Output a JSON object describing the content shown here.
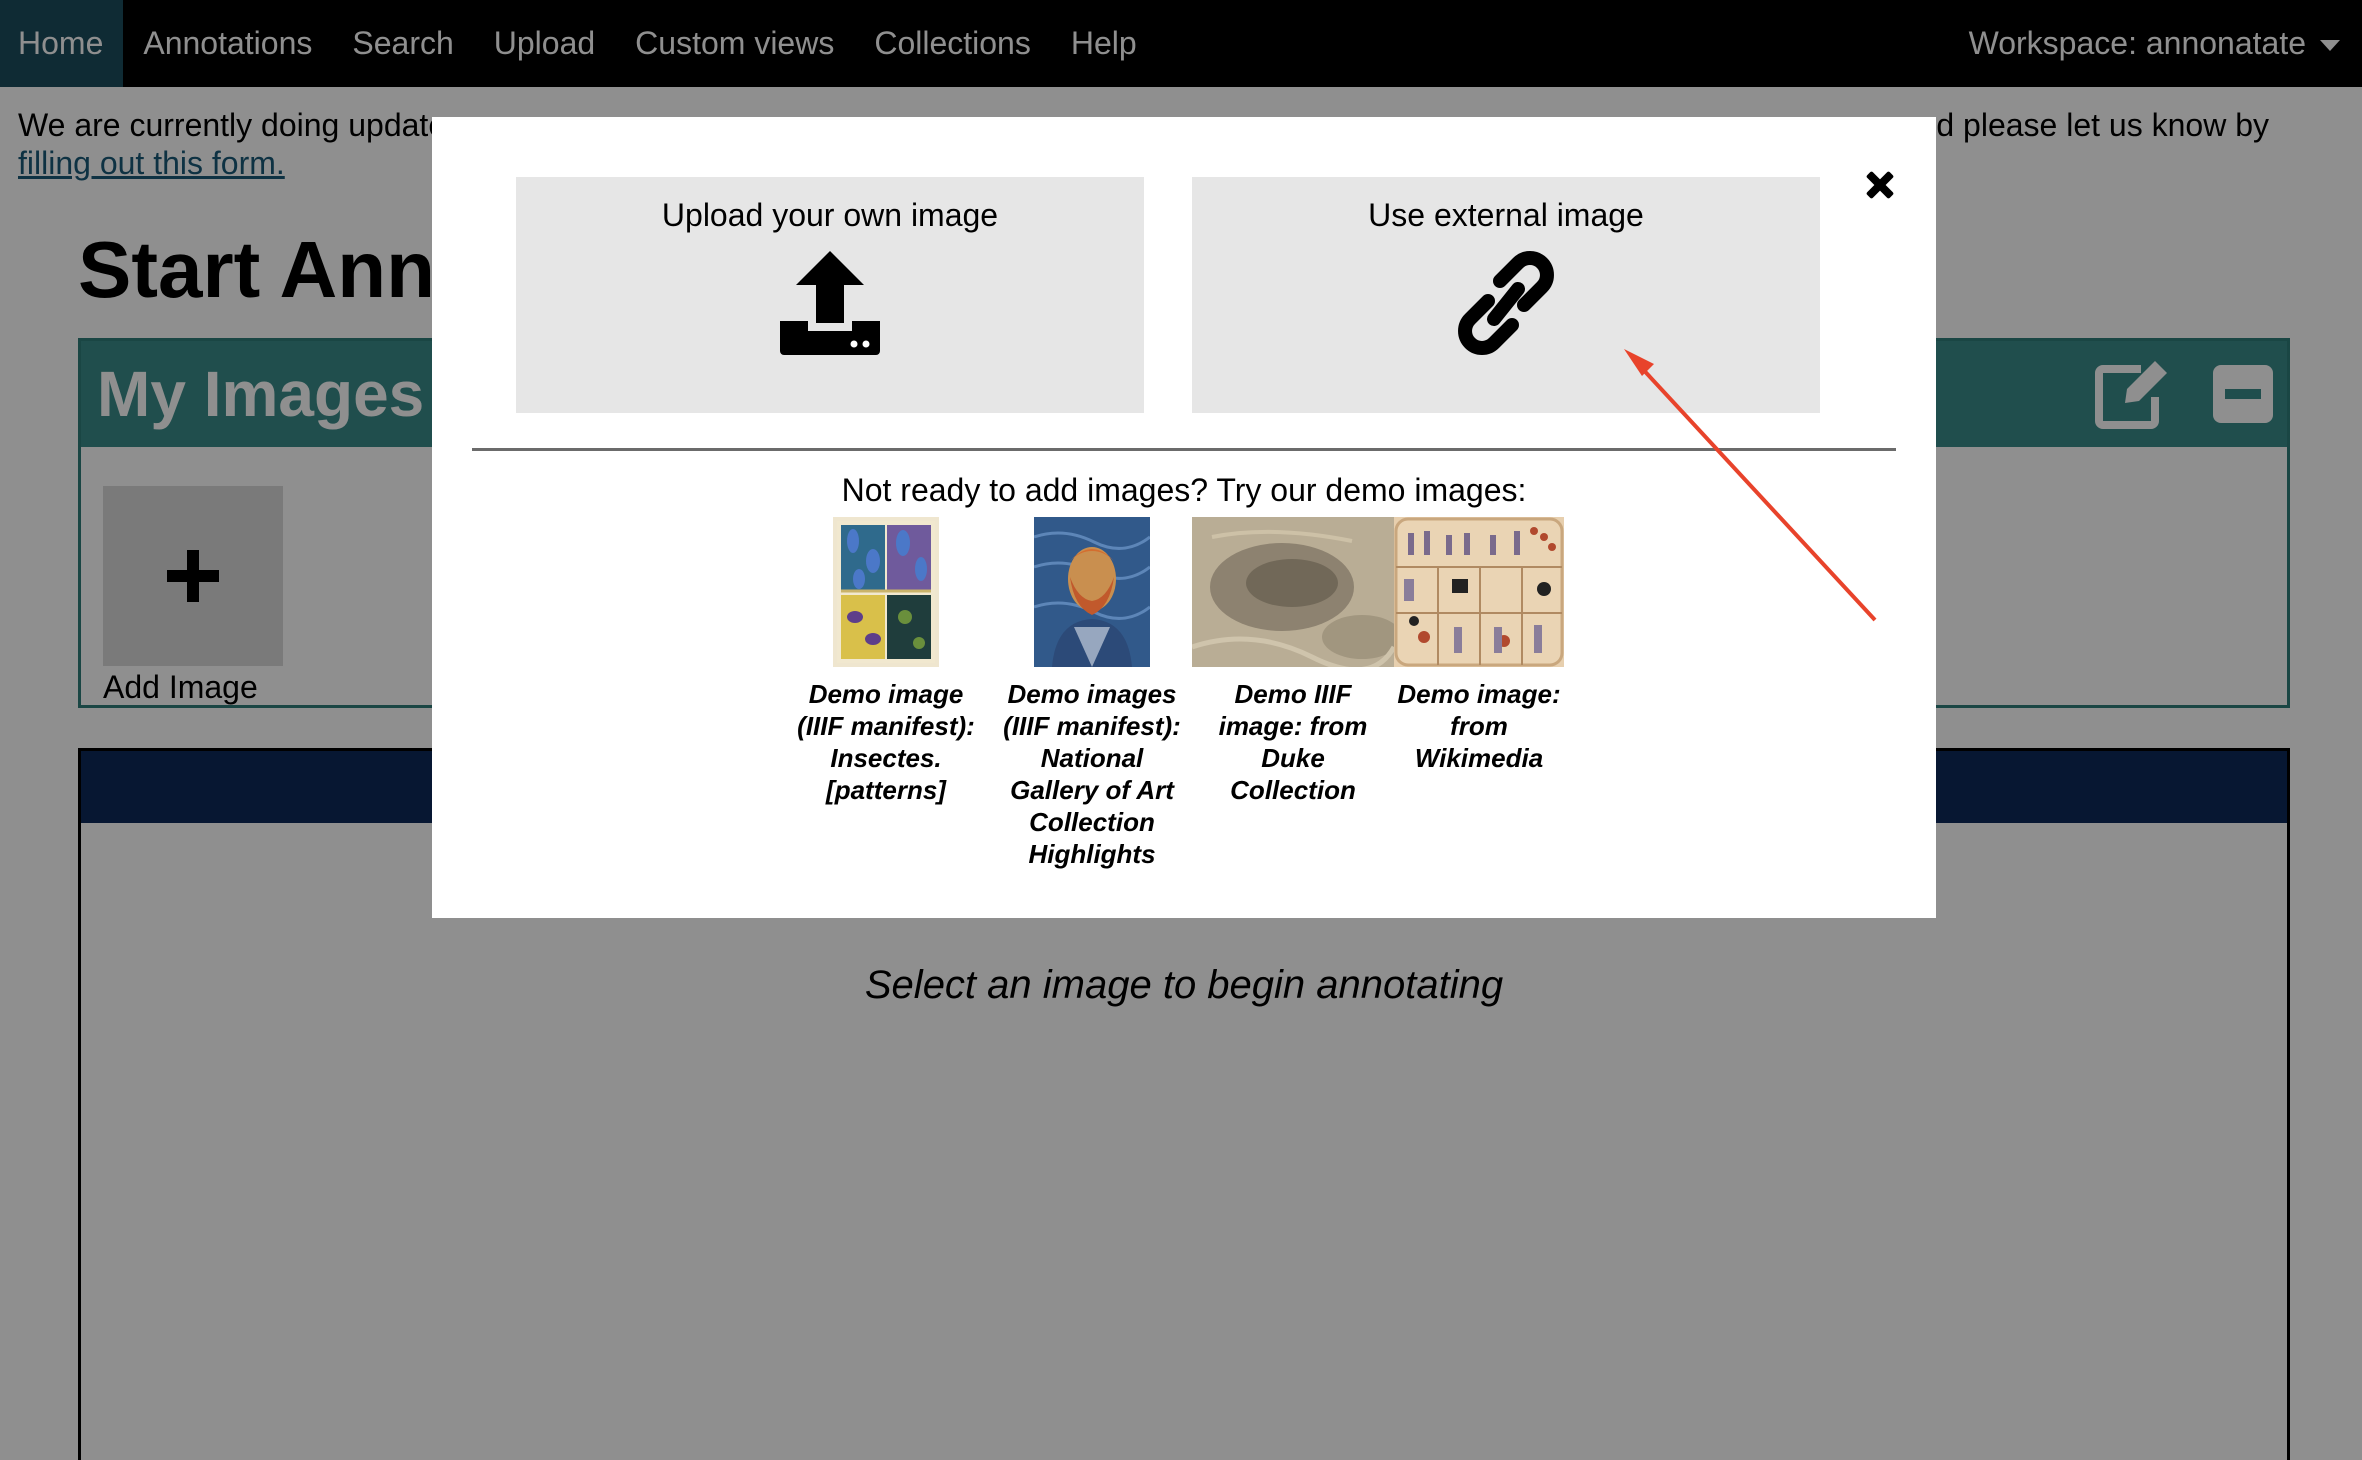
{
  "nav": {
    "items": [
      "Home",
      "Annotations",
      "Search",
      "Upload",
      "Custom views",
      "Collections",
      "Help"
    ],
    "workspace_label": "Workspace: annonatate"
  },
  "banner": {
    "text_start": "We are currently doing update",
    "text_end": "d please let us know by",
    "link_text": "filling out this form."
  },
  "page": {
    "title": "Start Anno"
  },
  "my_images": {
    "title": "My Images",
    "add_label": "Add Image"
  },
  "viewer": {
    "message": "Select an image to begin annotating"
  },
  "modal": {
    "upload_label": "Upload your own image",
    "external_label": "Use external image",
    "demo_heading": "Not ready to add images? Try our demo images:",
    "demos": [
      {
        "caption": "Demo image (IIIF manifest): Insectes. [patterns]"
      },
      {
        "caption": "Demo images (IIIF manifest): National Gallery of Art Collection Highlights"
      },
      {
        "caption": "Demo IIIF image: from Duke Collection"
      },
      {
        "caption": "Demo image: from Wikimedia"
      }
    ]
  },
  "colors": {
    "nav_bg": "#000000",
    "nav_active": "#1b4e5e",
    "panel_teal": "#3a8c89",
    "viewer_bar": "#0e2a5a",
    "link": "#1a5a78",
    "arrow": "#e8432b"
  }
}
